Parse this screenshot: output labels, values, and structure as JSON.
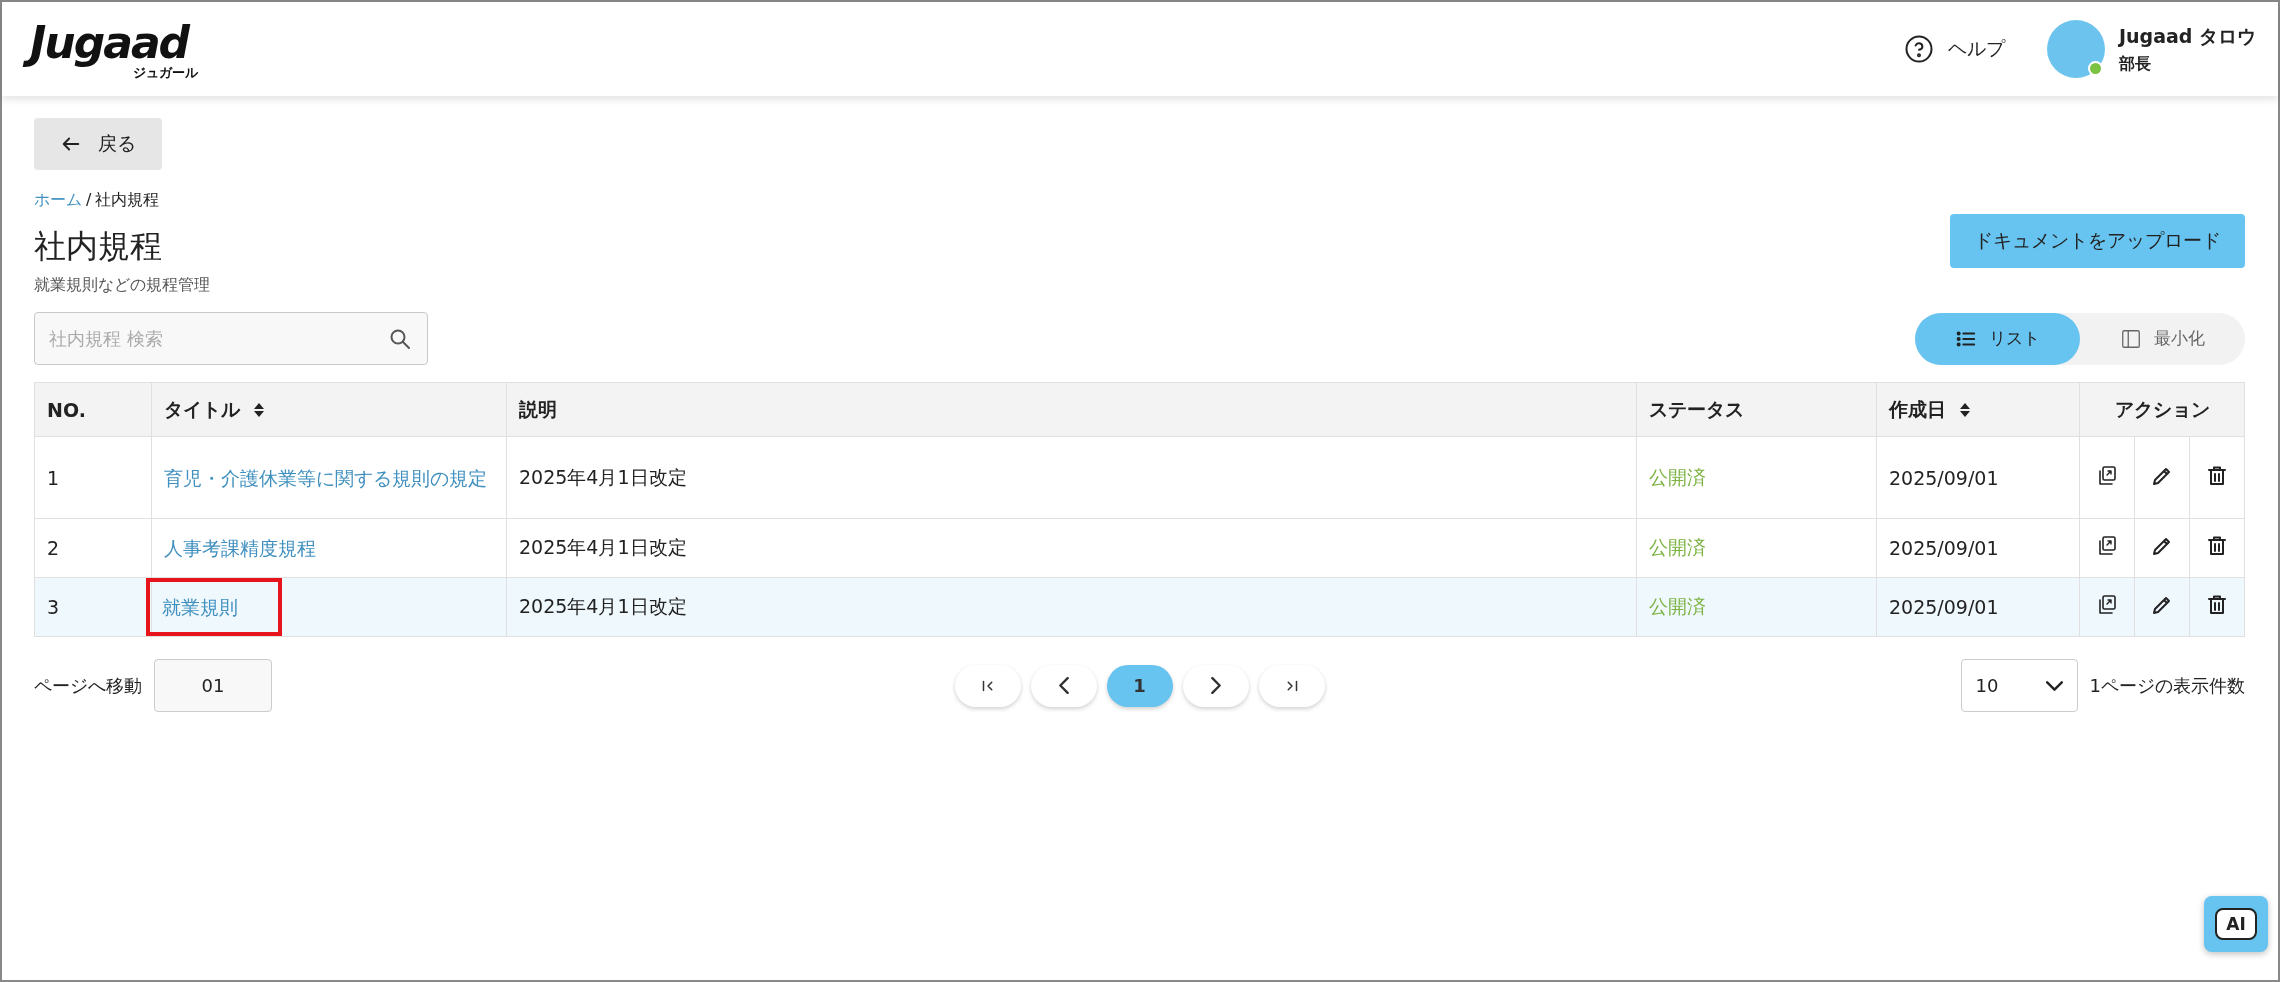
{
  "header": {
    "logo": "Jugaad",
    "logo_sub": "ジュガール",
    "help": "ヘルプ",
    "user": {
      "name": "Jugaad タロウ",
      "role": "部長",
      "online": true
    }
  },
  "back_button": "戻る",
  "breadcrumb": {
    "items": [
      {
        "label": "ホーム",
        "link": true
      },
      {
        "label": "社内規程",
        "link": false
      }
    ],
    "separator": "/"
  },
  "title": "社内規程",
  "subtitle": "就業規則などの規程管理",
  "search": {
    "placeholder": "社内規程 検索"
  },
  "upload_button": "ドキュメントをアップロード",
  "view_toggle": [
    {
      "label": "リスト",
      "kind": "list",
      "selected": true
    },
    {
      "label": "最小化",
      "kind": "panel",
      "selected": false
    }
  ],
  "table": {
    "columns": [
      {
        "label": "NO.",
        "sortable": false
      },
      {
        "label": "タイトル",
        "sortable": true
      },
      {
        "label": "説明",
        "sortable": false
      },
      {
        "label": "ステータス",
        "sortable": false
      },
      {
        "label": "作成日",
        "sortable": true
      },
      {
        "label": "アクション",
        "sortable": false
      }
    ],
    "rows": [
      {
        "no": "1",
        "title": "育児・介護休業等に関する規則の規定",
        "description": "2025年4月1日改定",
        "status": "公開済",
        "created": "2025/09/01",
        "selected": false,
        "highlighted": false
      },
      {
        "no": "2",
        "title": "人事考課精度規程",
        "description": "2025年4月1日改定",
        "status": "公開済",
        "created": "2025/09/01",
        "selected": false,
        "highlighted": false
      },
      {
        "no": "3",
        "title": "就業規則",
        "description": "2025年4月1日改定",
        "status": "公開済",
        "created": "2025/09/01",
        "selected": true,
        "highlighted": true
      }
    ]
  },
  "pagination": {
    "goto_label": "ページへ移動",
    "goto_value": "01",
    "pages": [
      {
        "label": "1",
        "selected": true
      }
    ],
    "per_page": "10",
    "per_page_label": "1ページの表示件数"
  },
  "ai_button": "AI"
}
